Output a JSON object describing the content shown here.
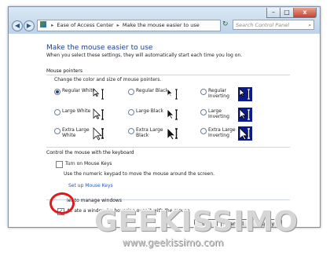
{
  "window": {
    "controls": {
      "minimize": "–",
      "maximize": "□",
      "close": "x"
    }
  },
  "nav": {
    "back": "◀",
    "forward": "▶",
    "dropdown": "▾",
    "refresh": "↻"
  },
  "address": {
    "root_icon": "control-panel-icon",
    "crumb1": "Ease of Access Center",
    "crumb2": "Make the mouse easier to use",
    "separator": "▸"
  },
  "search": {
    "placeholder": "Search Control Panel",
    "icon": "search-icon"
  },
  "page": {
    "heading": "Make the mouse easier to use",
    "intro": "When you select these settings, they will automatically start each time you log on."
  },
  "pointers": {
    "section_title": "Mouse pointers",
    "instruction": "Change the color and size of mouse pointers.",
    "options": [
      {
        "label": "Regular White",
        "selected": true,
        "scheme": "white"
      },
      {
        "label": "Regular Black",
        "selected": false,
        "scheme": "black"
      },
      {
        "label": "Regular Inverting",
        "selected": false,
        "scheme": "inverting"
      },
      {
        "label": "Large White",
        "selected": false,
        "scheme": "white"
      },
      {
        "label": "Large Black",
        "selected": false,
        "scheme": "black"
      },
      {
        "label": "Large Inverting",
        "selected": false,
        "scheme": "inverting"
      },
      {
        "label": "Extra Large White",
        "selected": false,
        "scheme": "white"
      },
      {
        "label": "Extra Large Black",
        "selected": false,
        "scheme": "black"
      },
      {
        "label": "Extra Large Inverting",
        "selected": false,
        "scheme": "inverting"
      }
    ]
  },
  "keyboard": {
    "section_title": "Control the mouse with the keyboard",
    "mouse_keys_label": "Turn on Mouse Keys",
    "mouse_keys_checked": false,
    "description": "Use the numeric keypad to move the mouse around the screen.",
    "setup_link": "Set up Mouse Keys"
  },
  "windows": {
    "section_title": "ier to manage windows",
    "hover_label": "Ac    ate a window by hovering over it with the mouse",
    "hover_checked": true
  },
  "buttons": {
    "ok": "OK",
    "cancel": "Cancel",
    "apply": "Apply"
  },
  "watermark": {
    "brand": "GEEKISSIMO",
    "url": "www.geekissimo.com"
  },
  "colors": {
    "highlight_circle": "#e01a1a",
    "heading": "#1c3f8c",
    "link": "#1f57c7"
  }
}
